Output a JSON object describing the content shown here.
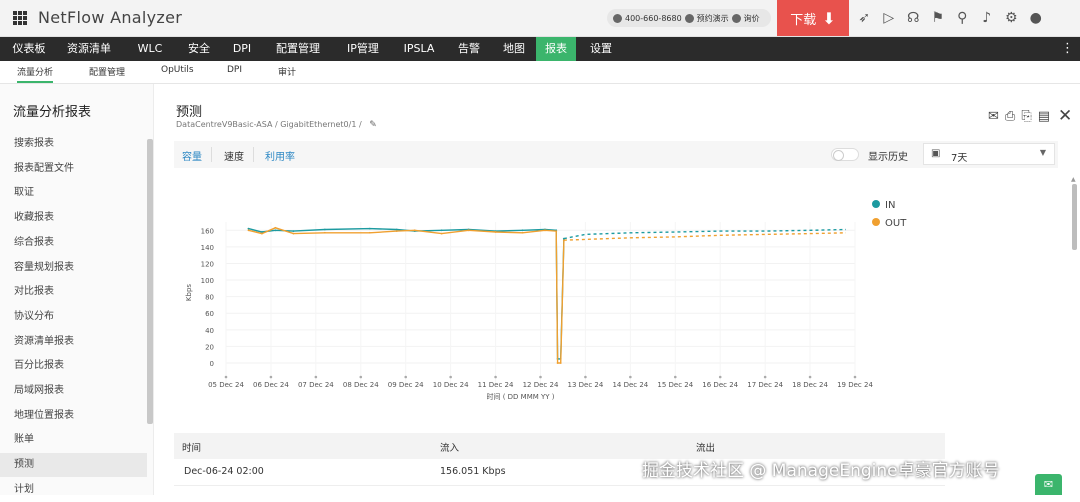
{
  "app": {
    "title": "NetFlow Analyzer"
  },
  "header": {
    "phone": "400-660-8680",
    "demo_label": "预约演示",
    "price_label": "询价",
    "download_label": "下载",
    "download_arrow": "⬇",
    "icons": [
      "rocket-icon",
      "presentation-icon",
      "support-icon",
      "gift-icon",
      "search-icon",
      "bell-icon",
      "gear-icon",
      "user-icon"
    ],
    "icon_glyphs": [
      "➶",
      "▷",
      "☊",
      "⚑",
      "⚲",
      "♪",
      "⚙",
      "●"
    ]
  },
  "main_nav": {
    "items": [
      "仪表板",
      "资源清单",
      "WLC",
      "安全",
      "DPI",
      "配置管理",
      "IP管理",
      "IPSLA",
      "告警",
      "地图",
      "报表",
      "设置"
    ],
    "active": "报表"
  },
  "sub_nav": {
    "items": [
      "流量分析",
      "配置管理",
      "OpUtils",
      "DPI",
      "审计"
    ],
    "active": "流量分析"
  },
  "sidebar": {
    "title": "流量分析报表",
    "items": [
      "搜索报表",
      "报表配置文件",
      "取证",
      "收藏报表",
      "综合报表",
      "容量规划报表",
      "对比报表",
      "协议分布",
      "资源清单报表",
      "百分比报表",
      "局域网报表",
      "地理位置报表",
      "账单",
      "预测",
      "计划"
    ],
    "active": "预测"
  },
  "page": {
    "title": "预测",
    "breadcrumb": "DataCentreV9Basic-ASA  /  GigabitEthernet0/1  /",
    "edit_glyph": "✎",
    "action_glyphs": [
      "✉",
      "⎙",
      "⎘",
      "▤",
      "✕"
    ]
  },
  "toolbar": {
    "tabs": [
      "容量",
      "速度",
      "利用率"
    ],
    "history_label": "显示历史",
    "history_enabled": false,
    "period": "7天",
    "calendar_glyph": "▣",
    "caret_glyph": "▼"
  },
  "chart_data": {
    "type": "line",
    "xlabel": "时间 ( DD MMM YY )",
    "ylabel": "Kbps",
    "ylim": [
      0,
      170
    ],
    "yticks": [
      0,
      20,
      40,
      60,
      80,
      100,
      120,
      140,
      160
    ],
    "x_tick_labels": [
      "05 Dec 24",
      "06 Dec 24",
      "07 Dec 24",
      "08 Dec 24",
      "09 Dec 24",
      "10 Dec 24",
      "11 Dec 24",
      "12 Dec 24",
      "13 Dec 24",
      "14 Dec 24",
      "15 Dec 24",
      "16 Dec 24",
      "17 Dec 24",
      "18 Dec 24",
      "19 Dec 24"
    ],
    "legend_position": "top-right",
    "series": [
      {
        "name": "IN",
        "color": "#1c9aa0",
        "points": [
          [
            5.5,
            162
          ],
          [
            5.8,
            158
          ],
          [
            6.1,
            160
          ],
          [
            6.5,
            159
          ],
          [
            7.2,
            161
          ],
          [
            8.2,
            162
          ],
          [
            8.8,
            161
          ],
          [
            9.2,
            159
          ],
          [
            9.8,
            160
          ],
          [
            10.4,
            161
          ],
          [
            11.0,
            159
          ],
          [
            11.6,
            160
          ],
          [
            12.1,
            161
          ],
          [
            12.35,
            160
          ],
          [
            12.38,
            5
          ],
          [
            12.45,
            5
          ],
          [
            12.52,
            150
          ]
        ]
      },
      {
        "name": "OUT",
        "color": "#f0a030",
        "points": [
          [
            5.5,
            160
          ],
          [
            5.8,
            156
          ],
          [
            6.1,
            163
          ],
          [
            6.5,
            156
          ],
          [
            7.2,
            157
          ],
          [
            8.2,
            157
          ],
          [
            8.8,
            159
          ],
          [
            9.2,
            160
          ],
          [
            9.8,
            156
          ],
          [
            10.4,
            160
          ],
          [
            11.0,
            158
          ],
          [
            11.6,
            157
          ],
          [
            12.1,
            160
          ],
          [
            12.35,
            159
          ],
          [
            12.38,
            0
          ],
          [
            12.45,
            0
          ],
          [
            12.52,
            148
          ]
        ]
      },
      {
        "name": "IN forecast",
        "color": "#1c9aa0",
        "dashed": true,
        "points": [
          [
            12.52,
            150
          ],
          [
            13.0,
            155
          ],
          [
            14.0,
            157
          ],
          [
            15.0,
            158
          ],
          [
            16.0,
            159
          ],
          [
            17.0,
            159
          ],
          [
            18.0,
            160
          ],
          [
            18.8,
            161
          ]
        ]
      },
      {
        "name": "OUT forecast",
        "color": "#f0a030",
        "dashed": true,
        "points": [
          [
            12.52,
            148
          ],
          [
            13.0,
            149
          ],
          [
            14.0,
            151
          ],
          [
            15.0,
            152
          ],
          [
            16.0,
            154
          ],
          [
            17.0,
            155
          ],
          [
            18.0,
            156
          ],
          [
            18.8,
            157
          ]
        ]
      }
    ]
  },
  "table": {
    "headers": [
      "时间",
      "流入",
      "流出"
    ],
    "rows": [
      [
        "Dec-06-24 02:00",
        "156.051 Kbps",
        ""
      ]
    ]
  },
  "watermark": "掘金技术社区 @ ManageEngine卓豪官方账号",
  "chat_glyph": "✉"
}
